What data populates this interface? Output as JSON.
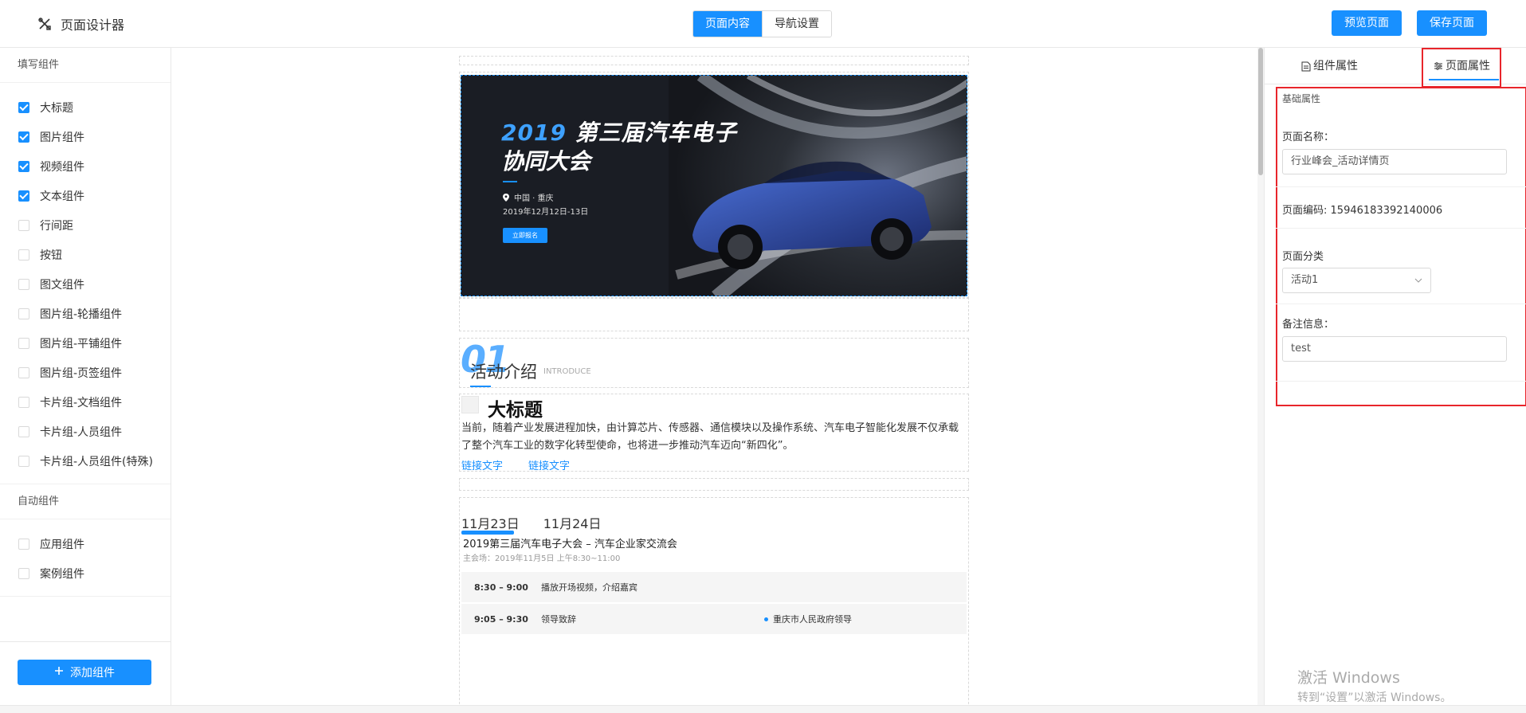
{
  "header": {
    "app_title": "页面设计器",
    "mode_tabs": [
      {
        "label": "页面内容",
        "active": true
      },
      {
        "label": "导航设置",
        "active": false
      }
    ],
    "preview_label": "预览页面",
    "save_label": "保存页面",
    "accent_color": "#1890ff"
  },
  "sidebar": {
    "group_fill": {
      "title": "填写组件",
      "items": [
        {
          "label": "大标题",
          "checked": true
        },
        {
          "label": "图片组件",
          "checked": true
        },
        {
          "label": "视频组件",
          "checked": true
        },
        {
          "label": "文本组件",
          "checked": true
        },
        {
          "label": "行间距",
          "checked": false
        },
        {
          "label": "按钮",
          "checked": false
        },
        {
          "label": "图文组件",
          "checked": false
        },
        {
          "label": "图片组-轮播组件",
          "checked": false
        },
        {
          "label": "图片组-平铺组件",
          "checked": false
        },
        {
          "label": "图片组-页签组件",
          "checked": false
        },
        {
          "label": "卡片组-文档组件",
          "checked": false
        },
        {
          "label": "卡片组-人员组件",
          "checked": false
        },
        {
          "label": "卡片组-人员组件(特殊)",
          "checked": false
        }
      ]
    },
    "group_auto": {
      "title": "自动组件",
      "items": [
        {
          "label": "应用组件",
          "checked": false
        },
        {
          "label": "案例组件",
          "checked": false
        }
      ]
    },
    "add_button_label": "添加组件"
  },
  "canvas": {
    "banner": {
      "title_year": "2019",
      "title_rest": "第三届汽车电子",
      "title_line2": "协同大会",
      "location": "中国 · 重庆",
      "date": "2019年12月12日-13日",
      "register_label": "立即报名"
    },
    "section": {
      "number": "01",
      "title": "活动介绍",
      "subtitle": "INTRODUCE"
    },
    "big_title": {
      "heading": "大标题",
      "paragraph": "当前，随着产业发展进程加快，由计算芯片、传感器、通信模块以及操作系统、汽车电子智能化发展不仅承载了整个汽车工业的数字化转型使命，也将进一步推动汽车迈向“新四化”。",
      "links": [
        "链接文字",
        "链接文字"
      ]
    },
    "agenda": {
      "tabs": [
        "11月23日",
        "11月24日"
      ],
      "title": "2019第三届汽车电子大会 – 汽车企业家交流会",
      "subtitle": "主会场：2019年11月5日 上午8:30~11:00",
      "rows": [
        {
          "time": "8:30 – 9:00",
          "desc": "播放开场视频，介绍嘉宾",
          "who": ""
        },
        {
          "time": "9:05 – 9:30",
          "desc": "领导致辞",
          "who": "重庆市人民政府领导"
        }
      ]
    }
  },
  "right_panel": {
    "tabs": [
      {
        "label": "组件属性",
        "active": false
      },
      {
        "label": "页面属性",
        "active": true
      }
    ],
    "section_title": "基础属性",
    "page_name_label": "页面名称：",
    "page_name_value": "行业峰会_活动详情页",
    "page_code_label": "页面编码:",
    "page_code_value": "15946183392140006",
    "category_label": "页面分类",
    "category_value": "活动1",
    "remark_label": "备注信息：",
    "remark_value": "test",
    "highlight_color": "#e8252b"
  },
  "watermark": {
    "line1": "激活 Windows",
    "line2": "转到“设置”以激活 Windows。"
  }
}
